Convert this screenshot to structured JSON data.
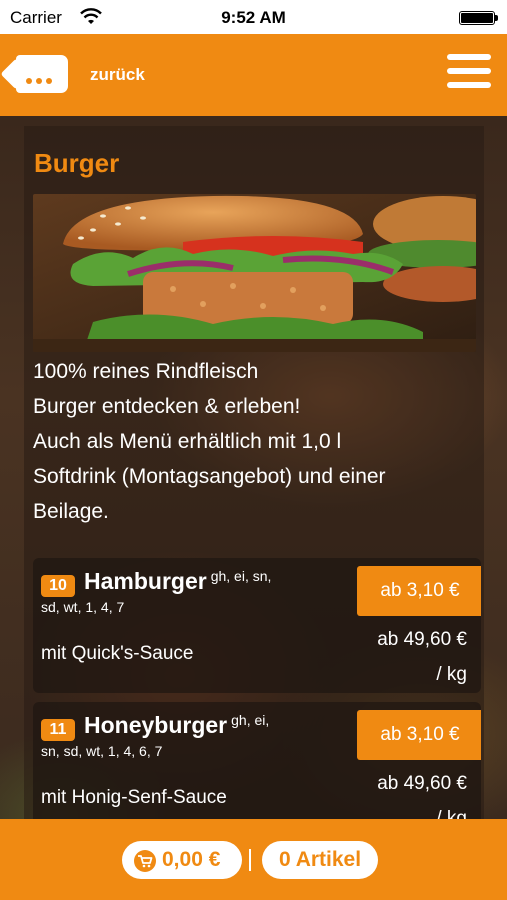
{
  "status_bar": {
    "carrier": "Carrier",
    "time": "9:52 AM"
  },
  "header": {
    "back_label": "zurück",
    "accent_color": "#f08a12"
  },
  "category": {
    "title": "Burger",
    "description_lines": [
      "100% reines Rindfleisch",
      "Burger entdecken & erleben!",
      "Auch als Menü erhältlich mit 1,0 l",
      "Softdrink (Montagsangebot) und einer",
      "Beilage."
    ]
  },
  "items": [
    {
      "number": "10",
      "name": "Hamburger",
      "allergens_sup": "gh, ei, sn,",
      "allergens_line2": "sd, wt, 1, 4, 7",
      "description": "mit Quick's-Sauce",
      "price": "ab 3,10 €",
      "price_per_kg_line1": "ab 49,60 €",
      "price_per_kg_line2": "/ kg"
    },
    {
      "number": "11",
      "name": "Honeyburger",
      "allergens_sup": "gh, ei,",
      "allergens_line2": "sn, sd, wt, 1, 4, 6, 7",
      "description": "mit Honig-Senf-Sauce",
      "price": "ab 3,10 €",
      "price_per_kg_line1": "ab 49,60 €",
      "price_per_kg_line2": "/ kg"
    }
  ],
  "footer": {
    "cart_total": "0,00 €",
    "cart_items": "0 Artikel",
    "icons": [
      "cart-icon"
    ]
  }
}
